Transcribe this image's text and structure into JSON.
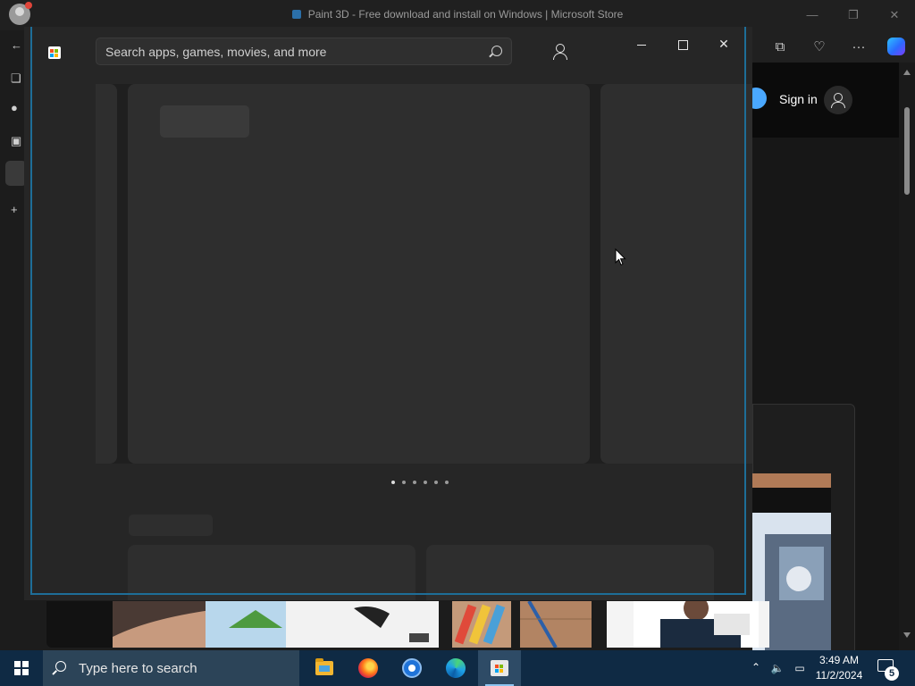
{
  "browser": {
    "title": "Paint 3D - Free download and install on Windows | Microsoft Store",
    "window_controls": {
      "minimize": "—",
      "restore": "❐",
      "close": "✕"
    },
    "toolbar_icons": [
      "collections-icon",
      "health-icon",
      "more-icon",
      "copilot-icon"
    ],
    "toolbar_more": "···",
    "sign_in_label": "Sign in"
  },
  "store": {
    "search": {
      "placeholder": "Search apps, games, movies, and more"
    },
    "window_controls": {
      "close": "✕"
    },
    "carousel_pages": 6,
    "carousel_active": 0
  },
  "taskbar": {
    "search_placeholder": "Type here to search",
    "apps": [
      "file-explorer",
      "firefox",
      "chrome",
      "edge",
      "microsoft-store"
    ],
    "clock": {
      "time": "3:49 AM",
      "date": "11/2/2024"
    },
    "notification_count": "5",
    "accent": "#0f2a44"
  },
  "colors": {
    "store_frame": "#1e6e98",
    "skeleton": "#2e2e2e",
    "store_bg": "#262626"
  }
}
